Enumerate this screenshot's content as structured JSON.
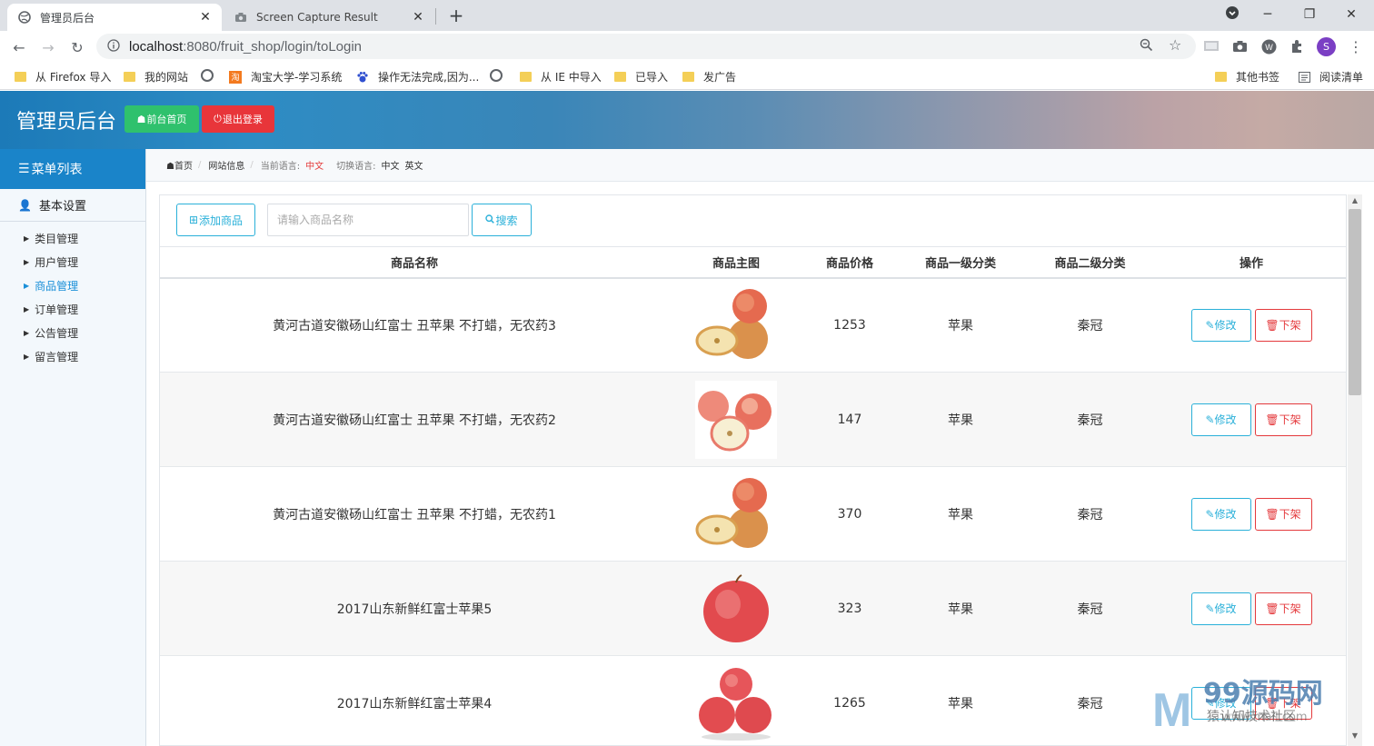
{
  "browser": {
    "tabs": [
      {
        "title": "管理员后台",
        "active": true
      },
      {
        "title": "Screen Capture Result",
        "active": false
      }
    ],
    "url_host": "localhost",
    "url_path": ":8080/fruit_shop/login/toLogin",
    "bookmarks": [
      "从 Firefox 导入",
      "我的网站",
      "淘宝大学-学习系统",
      "操作无法完成,因为...",
      "从 IE 中导入",
      "已导入",
      "发广告",
      "其他书签",
      "阅读清单"
    ],
    "profile_initial": "S"
  },
  "header": {
    "title": "管理员后台",
    "home_button": "前台首页",
    "logout_button": "退出登录",
    "brand_color": "#1a84c9"
  },
  "sidebar": {
    "menu_title": "菜单列表",
    "group": "基本设置",
    "items": [
      {
        "label": "类目管理",
        "active": false
      },
      {
        "label": "用户管理",
        "active": false
      },
      {
        "label": "商品管理",
        "active": true
      },
      {
        "label": "订单管理",
        "active": false
      },
      {
        "label": "公告管理",
        "active": false
      },
      {
        "label": "留言管理",
        "active": false
      }
    ]
  },
  "breadcrumb": {
    "home": "首页",
    "site_info": "网站信息",
    "current_lang_label": "当前语言:",
    "current_lang": "中文",
    "switch_lang_label": "切换语言:",
    "lang_zh": "中文",
    "lang_en": "英文"
  },
  "toolbar": {
    "add_button": "添加商品",
    "search_placeholder": "请输入商品名称",
    "search_value": "",
    "search_button": "搜索"
  },
  "table": {
    "columns": [
      "商品名称",
      "商品主图",
      "商品价格",
      "商品一级分类",
      "商品二级分类",
      "操作"
    ],
    "edit_label": "修改",
    "delete_label": "下架",
    "rows": [
      {
        "name": "黄河古道安徽砀山红富士 丑苹果 不打蜡，无农药3",
        "image": "apples-stack",
        "price": "1253",
        "cat1": "苹果",
        "cat2": "秦冠"
      },
      {
        "name": "黄河古道安徽砀山红富士 丑苹果 不打蜡，无农药2",
        "image": "apples-cut",
        "price": "147",
        "cat1": "苹果",
        "cat2": "秦冠"
      },
      {
        "name": "黄河古道安徽砀山红富士 丑苹果 不打蜡，无农药1",
        "image": "apples-stack",
        "price": "370",
        "cat1": "苹果",
        "cat2": "秦冠"
      },
      {
        "name": "2017山东新鲜红富士苹果5",
        "image": "apple-single",
        "price": "323",
        "cat1": "苹果",
        "cat2": "秦冠"
      },
      {
        "name": "2017山东新鲜红富士苹果4",
        "image": "apples-three",
        "price": "1265",
        "cat1": "苹果",
        "cat2": "秦冠"
      }
    ]
  },
  "watermark": {
    "name": "99源码网",
    "sub": "猿认知技术社区",
    "url": "www.mall.com"
  }
}
